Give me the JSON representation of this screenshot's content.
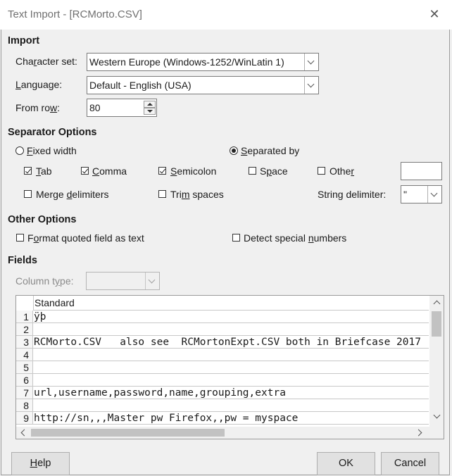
{
  "window": {
    "title": "Text Import - [RCMorto.CSV]"
  },
  "import": {
    "heading": "Import",
    "charset_label": "Character set:",
    "charset_value": "Western Europe (Windows-1252/WinLatin 1)",
    "language_label": "Language:",
    "language_value": "Default - English (USA)",
    "fromrow_label": "From row:",
    "fromrow_value": "80"
  },
  "separator": {
    "heading": "Separator Options",
    "fixed_width": "Fixed width",
    "separated_by": "Separated by",
    "mode": "separated_by",
    "tab": "Tab",
    "comma": "Comma",
    "semicolon": "Semicolon",
    "space": "Space",
    "other": "Other",
    "merge_delimiters": "Merge delimiters",
    "trim_spaces": "Trim spaces",
    "string_delimiter_label": "String delimiter:",
    "string_delimiter_value": "\"",
    "checked": {
      "tab": true,
      "comma": true,
      "semicolon": true,
      "space": false,
      "other": false,
      "merge": false,
      "trim": false
    }
  },
  "other_options": {
    "heading": "Other Options",
    "format_quoted": "Format quoted field as text",
    "detect_numbers": "Detect special numbers",
    "checked": {
      "format_quoted": false,
      "detect_numbers": false
    }
  },
  "fields": {
    "heading": "Fields",
    "column_type_label": "Column type:",
    "column_header": "Standard",
    "row_numbers": [
      "1",
      "2",
      "3",
      "4",
      "5",
      "6",
      "7",
      "8",
      "9"
    ],
    "rows": [
      "ÿþ",
      "",
      "RCMorto.CSV   also see  RCMortonExpt.CSV both in Briefcase 2017",
      "",
      "",
      "",
      "url,username,password,name,grouping,extra",
      "",
      "http://sn,,,Master pw Firefox,,pw = myspace"
    ]
  },
  "buttons": {
    "help": "Help",
    "ok": "OK",
    "cancel": "Cancel"
  }
}
